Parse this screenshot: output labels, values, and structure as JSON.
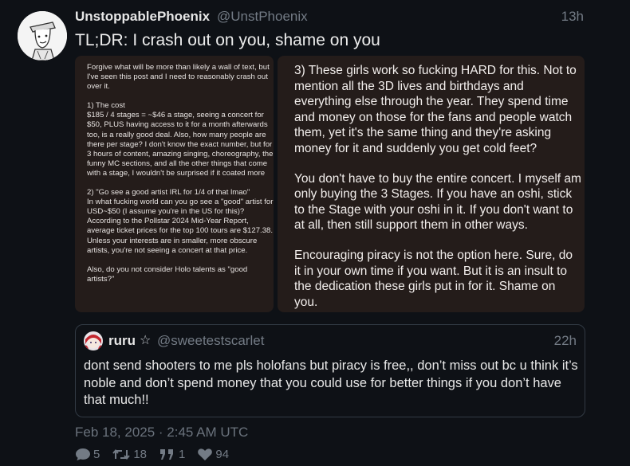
{
  "post": {
    "author_name": "UnstoppablePhoenix",
    "author_handle": "@UnstPhoenix",
    "time": "13h",
    "text": "TL;DR: I crash out on you, shame on you"
  },
  "media_left": {
    "paragraphs": [
      "Forgive what will be more than likely a wall of text, but I've seen this post and I need to reasonably crash out over it.",
      "1) The cost\n$185 / 4 stages = ~$46 a stage, seeing a concert for $50, PLUS having access to it for a month afterwards too, is a really good deal. Also, how many people are there per stage? I don't know the exact number, but for 3 hours of content, amazing singing, choreography, the funny MC sections, and all the other things that come with a stage, I wouldn't be surprised if it coated more",
      "2) \"Go see a good artist IRL for 1/4 of that lmao\"\nIn what fucking world can you go see a \"good\" artist for USD~$50 (I assume you're in the US for this)? According to the Pollstar 2024 Mid-Year Report, average ticket prices for the top 100 tours are $127.38. Unless your interests are in smaller, more obscure artists, you're not seeing a concert at that price.",
      "Also, do you not consider Holo talents as \"good artists?\""
    ]
  },
  "media_right": {
    "paragraphs": [
      "3) These girls work so fucking HARD for this. Not to mention all the 3D lives and birthdays and everything else through the year. They spend time and money on those for the fans and people watch them, yet it's the same thing and they're asking money for it and suddenly you get cold feet?",
      "You don't have to buy the entire concert. I myself am only buying the 3 Stages. If you have an oshi, stick to the Stage with your oshi in it. If you don't want to at all, then still support them in other ways.",
      "Encouraging piracy is not the option here. Sure, do it in your own time if you want. But it is an insult to the dedication these girls put in for it. Shame on you."
    ]
  },
  "quote": {
    "author_name": "ruru",
    "star": "☆",
    "author_handle": "@sweetestscarlet",
    "time": "22h",
    "text": "dont send shooters to me pls holofans but piracy is free,, don’t miss out bc u think it’s noble and don’t spend money that you could use for better things if you don’t have that much!!"
  },
  "meta": {
    "date": "Feb 18, 2025 · 2:45 AM UTC"
  },
  "stats": {
    "replies": "5",
    "retweets": "18",
    "quotes": "1",
    "likes": "94"
  },
  "icons": [
    "comment-icon",
    "retweet-icon",
    "quote-icon",
    "heart-icon"
  ],
  "colors": {
    "background": "#0e1116",
    "muted_text": "#737b85",
    "media_background": "#241c1a",
    "quote_border": "#323a44"
  }
}
